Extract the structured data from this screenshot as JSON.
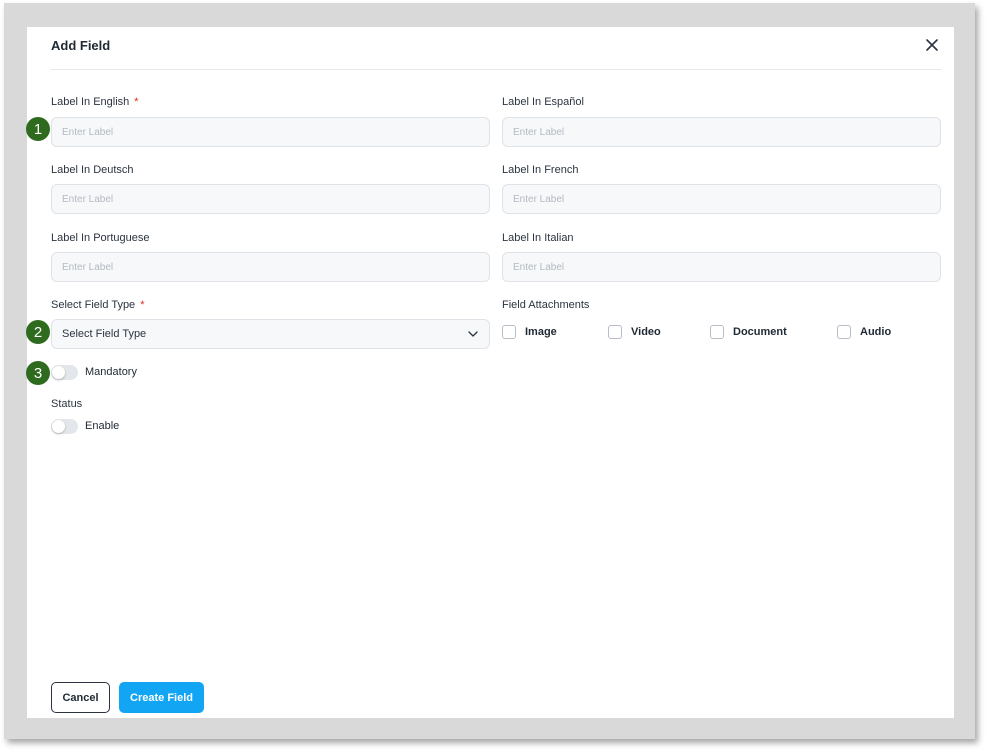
{
  "dialog": {
    "title": "Add Field",
    "close_icon": "close-icon"
  },
  "fields": {
    "english": {
      "label": "Label In English",
      "required_mark": "*",
      "placeholder": "Enter Label",
      "value": ""
    },
    "spanish": {
      "label": "Label In Español",
      "placeholder": "Enter Label",
      "value": ""
    },
    "deutsch": {
      "label": "Label In Deutsch",
      "placeholder": "Enter Label",
      "value": ""
    },
    "french": {
      "label": "Label In French",
      "placeholder": "Enter Label",
      "value": ""
    },
    "portuguese": {
      "label": "Label In Portuguese",
      "placeholder": "Enter Label",
      "value": ""
    },
    "italian": {
      "label": "Label In Italian",
      "placeholder": "Enter Label",
      "value": ""
    }
  },
  "field_type": {
    "label": "Select Field Type",
    "required_mark": "*",
    "selected": "Select Field Type",
    "chevron_icon": "chevron-down-icon"
  },
  "attachments": {
    "label": "Field Attachments",
    "options": [
      {
        "label": "Image",
        "checked": false
      },
      {
        "label": "Video",
        "checked": false
      },
      {
        "label": "Document",
        "checked": false
      },
      {
        "label": "Audio",
        "checked": false
      }
    ]
  },
  "mandatory": {
    "label": "Mandatory",
    "on": false
  },
  "status": {
    "label": "Status",
    "toggle_label": "Enable",
    "on": false
  },
  "callouts": [
    "1",
    "2",
    "3"
  ],
  "buttons": {
    "cancel": "Cancel",
    "create": "Create Field"
  },
  "colors": {
    "primary_button": "#12a5f4",
    "required_mark": "#d92d20",
    "callout_badge": "#2e6b1f"
  }
}
